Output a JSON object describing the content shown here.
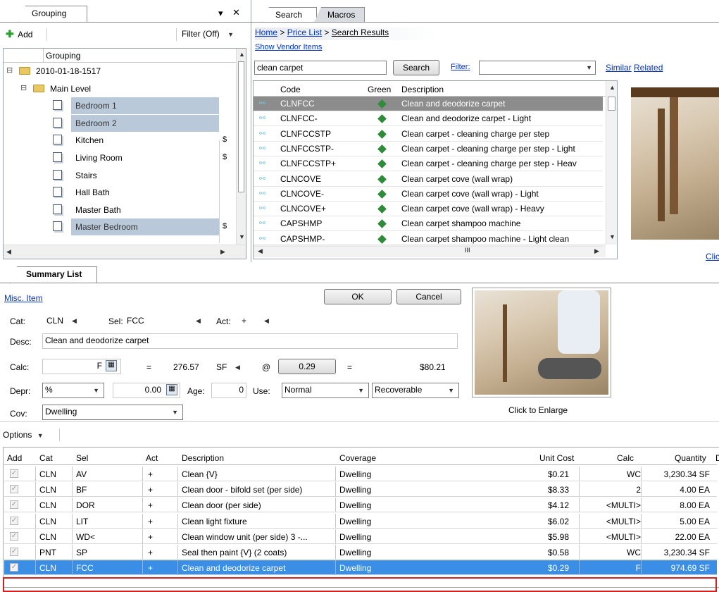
{
  "grouping_panel": {
    "tab_label": "Grouping",
    "pin_icon": "▾",
    "close_icon": "✕",
    "add_label": "Add",
    "filter_label": "Filter (Off)",
    "column_header": "Grouping",
    "tree": [
      {
        "label": "2010-01-18-1517",
        "level": 0,
        "type": "folder",
        "expander": "⊟",
        "selected": false,
        "amount": ""
      },
      {
        "label": "Main Level",
        "level": 1,
        "type": "folder",
        "expander": "⊟",
        "selected": false,
        "amount": ""
      },
      {
        "label": "Bedroom 1",
        "level": 2,
        "type": "room",
        "selected": true,
        "amount": ""
      },
      {
        "label": "Bedroom 2",
        "level": 2,
        "type": "room",
        "selected": true,
        "amount": ""
      },
      {
        "label": "Kitchen",
        "level": 2,
        "type": "room",
        "selected": false,
        "amount": "$"
      },
      {
        "label": "Living Room",
        "level": 2,
        "type": "room",
        "selected": false,
        "amount": "$"
      },
      {
        "label": "Stairs",
        "level": 2,
        "type": "room",
        "selected": false,
        "amount": ""
      },
      {
        "label": "Hall Bath",
        "level": 2,
        "type": "room",
        "selected": false,
        "amount": ""
      },
      {
        "label": "Master Bath",
        "level": 2,
        "type": "room",
        "selected": false,
        "amount": ""
      },
      {
        "label": "Master Bedroom",
        "level": 2,
        "type": "room",
        "selected": true,
        "amount": "$"
      }
    ]
  },
  "search_panel": {
    "tabs": [
      "Search",
      "Macros"
    ],
    "breadcrumb": {
      "home": "Home",
      "sep": ">",
      "price_list": "Price List",
      "results": "Search Results"
    },
    "show_vendor_items": "Show Vendor Items",
    "query": "clean carpet",
    "search_button": "Search",
    "filter_label": "Filter:",
    "filter_value": "",
    "similar": "Similar",
    "related": "Related",
    "columns": {
      "code": "Code",
      "green": "Green",
      "description": "Description"
    },
    "results": [
      {
        "code": "CLNFCC",
        "description": "Clean and deodorize carpet",
        "selected": true
      },
      {
        "code": "CLNFCC-",
        "description": "Clean and deodorize carpet - Light",
        "selected": false
      },
      {
        "code": "CLNFCCSTP",
        "description": "Clean carpet - cleaning charge per step",
        "selected": false
      },
      {
        "code": "CLNFCCSTP-",
        "description": "Clean carpet - cleaning charge per step - Light",
        "selected": false
      },
      {
        "code": "CLNFCCSTP+",
        "description": "Clean carpet - cleaning charge per step - Heav",
        "selected": false
      },
      {
        "code": "CLNCOVE",
        "description": "Clean carpet cove (wall wrap)",
        "selected": false
      },
      {
        "code": "CLNCOVE-",
        "description": "Clean carpet cove (wall wrap) - Light",
        "selected": false
      },
      {
        "code": "CLNCOVE+",
        "description": "Clean carpet cove (wall wrap) - Heavy",
        "selected": false
      },
      {
        "code": "CAPSHMP",
        "description": "Clean carpet shampoo machine",
        "selected": false
      },
      {
        "code": "CAPSHMP-",
        "description": "Clean carpet shampoo machine - Light clean",
        "selected": false
      }
    ],
    "click_label": "Click",
    "hscroll_thumb": "III"
  },
  "summary": {
    "tab_label": "Summary List",
    "misc_item": "Misc. Item",
    "ok": "OK",
    "cancel": "Cancel",
    "cat_label": "Cat:",
    "cat_value": "CLN",
    "sel_label": "Sel:",
    "sel_value": "FCC",
    "act_label": "Act:",
    "act_value": "+",
    "desc_label": "Desc:",
    "desc_value": "Clean and deodorize carpet",
    "calc_label": "Calc:",
    "calc_value": "F",
    "eq1": "=",
    "qty": "276.57",
    "unit": "SF",
    "at": "@",
    "unit_price": "0.29",
    "eq2": "=",
    "total": "$80.21",
    "depr_label": "Depr:",
    "depr_type": "%",
    "depr_value": "0.00",
    "age_label": "Age:",
    "age_value": "0",
    "use_label": "Use:",
    "use_value": "Normal",
    "recov_value": "Recoverable",
    "cov_label": "Cov:",
    "cov_value": "Dwelling",
    "click_to_enlarge": "Click to Enlarge",
    "options_label": "Options"
  },
  "line_items": {
    "columns": [
      "Add",
      "Cat",
      "Sel",
      "Act",
      "Description",
      "Coverage",
      "Unit Cost",
      "Calc",
      "Quantity",
      "D"
    ],
    "rows": [
      {
        "cat": "CLN",
        "sel": "AV",
        "act": "+",
        "desc": "Clean {V}",
        "cov": "Dwelling",
        "unit_cost": "$0.21",
        "calc": "WC",
        "qty": "3,230.34 SF",
        "selected": false
      },
      {
        "cat": "CLN",
        "sel": "BF",
        "act": "+",
        "desc": "Clean door - bifold set (per side)",
        "cov": "Dwelling",
        "unit_cost": "$8.33",
        "calc": "2",
        "qty": "4.00 EA",
        "selected": false
      },
      {
        "cat": "CLN",
        "sel": "DOR",
        "act": "+",
        "desc": "Clean door (per side)",
        "cov": "Dwelling",
        "unit_cost": "$4.12",
        "calc": "<MULTI>",
        "qty": "8.00 EA",
        "selected": false
      },
      {
        "cat": "CLN",
        "sel": "LIT",
        "act": "+",
        "desc": "Clean light fixture",
        "cov": "Dwelling",
        "unit_cost": "$6.02",
        "calc": "<MULTI>",
        "qty": "5.00 EA",
        "selected": false
      },
      {
        "cat": "CLN",
        "sel": "WD<",
        "act": "+",
        "desc": "Clean window unit (per side) 3 -...",
        "cov": "Dwelling",
        "unit_cost": "$5.98",
        "calc": "<MULTI>",
        "qty": "22.00 EA",
        "selected": false
      },
      {
        "cat": "PNT",
        "sel": "SP",
        "act": "+",
        "desc": "Seal then paint {V} (2 coats)",
        "cov": "Dwelling",
        "unit_cost": "$0.58",
        "calc": "WC",
        "qty": "3,230.34 SF",
        "selected": false
      },
      {
        "cat": "CLN",
        "sel": "FCC",
        "act": "+",
        "desc": "Clean and deodorize carpet",
        "cov": "Dwelling",
        "unit_cost": "$0.29",
        "calc": "F",
        "qty": "974.69 SF",
        "selected": true
      }
    ]
  },
  "colors": {
    "selection_blue": "#3a8ee6",
    "highlight_red": "#d32020",
    "tree_selected": "#b9c9da",
    "green_diamond": "#2e8b3a"
  }
}
